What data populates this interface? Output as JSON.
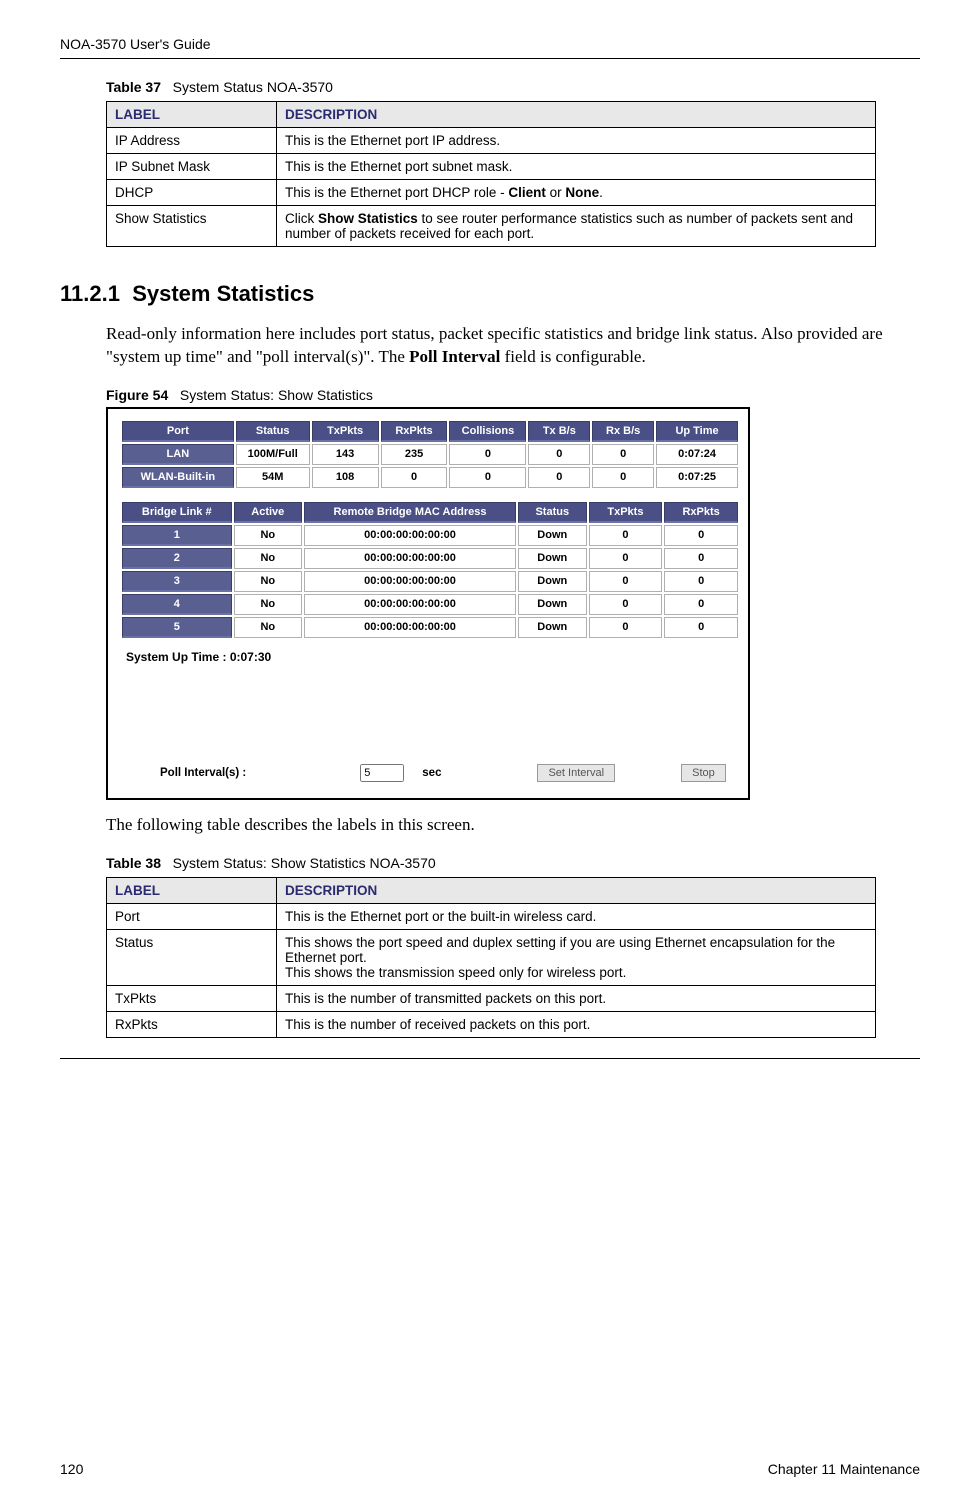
{
  "header": {
    "guide_title": "NOA-3570 User's Guide"
  },
  "table37": {
    "caption_prefix": "Table 37",
    "caption_text": "System Status NOA-3570",
    "col_label": "LABEL",
    "col_desc": "DESCRIPTION",
    "rows": [
      {
        "label": "IP Address",
        "desc": "This is the Ethernet port IP address."
      },
      {
        "label": "IP Subnet Mask",
        "desc": "This is the Ethernet port subnet mask."
      },
      {
        "label": "DHCP",
        "desc_pre": "This is the Ethernet port DHCP role - ",
        "b1": "Client",
        "mid": " or ",
        "b2": "None",
        "post": "."
      },
      {
        "label": "Show Statistics",
        "desc_pre": "Click ",
        "b1": "Show Statistics",
        "post": " to see router performance statistics such as number of packets sent and number of packets received for each port."
      }
    ]
  },
  "section": {
    "number": "11.2.1",
    "title": "System Statistics",
    "para_pre": "Read-only information here includes port status, packet specific statistics and bridge link status. Also provided are \"system up time\" and \"poll interval(s)\".  The ",
    "para_bold": "Poll Interval",
    "para_post": " field is configurable."
  },
  "figure54": {
    "caption_prefix": "Figure 54",
    "caption_text": "System Status: Show Statistics"
  },
  "chart_data": {
    "type": "table",
    "ports_table": {
      "headers": [
        "Port",
        "Status",
        "TxPkts",
        "RxPkts",
        "Collisions",
        "Tx B/s",
        "Rx B/s",
        "Up Time"
      ],
      "rows": [
        {
          "port": "LAN",
          "status": "100M/Full",
          "tx": "143",
          "rx": "235",
          "col": "0",
          "txbs": "0",
          "rxbs": "0",
          "up": "0:07:24"
        },
        {
          "port": "WLAN-Built-in",
          "status": "54M",
          "tx": "108",
          "rx": "0",
          "col": "0",
          "txbs": "0",
          "rxbs": "0",
          "up": "0:07:25"
        }
      ]
    },
    "bridge_table": {
      "headers": [
        "Bridge Link #",
        "Active",
        "Remote Bridge MAC Address",
        "Status",
        "TxPkts",
        "RxPkts"
      ],
      "rows": [
        {
          "n": "1",
          "active": "No",
          "mac": "00:00:00:00:00:00",
          "status": "Down",
          "tx": "0",
          "rx": "0"
        },
        {
          "n": "2",
          "active": "No",
          "mac": "00:00:00:00:00:00",
          "status": "Down",
          "tx": "0",
          "rx": "0"
        },
        {
          "n": "3",
          "active": "No",
          "mac": "00:00:00:00:00:00",
          "status": "Down",
          "tx": "0",
          "rx": "0"
        },
        {
          "n": "4",
          "active": "No",
          "mac": "00:00:00:00:00:00",
          "status": "Down",
          "tx": "0",
          "rx": "0"
        },
        {
          "n": "5",
          "active": "No",
          "mac": "00:00:00:00:00:00",
          "status": "Down",
          "tx": "0",
          "rx": "0"
        }
      ]
    },
    "system_up_time_label": "System Up Time :",
    "system_up_time_value": "0:07:30",
    "poll_label": "Poll Interval(s) :",
    "poll_value": "5",
    "poll_unit": "sec",
    "btn_set": "Set Interval",
    "btn_stop": "Stop"
  },
  "intro38": "The following table describes the labels in this screen.",
  "table38": {
    "caption_prefix": "Table 38",
    "caption_text": "System Status: Show Statistics NOA-3570",
    "col_label": "LABEL",
    "col_desc": "DESCRIPTION",
    "rows": [
      {
        "label": "Port",
        "desc": "This is the Ethernet port or the built-in wireless card."
      },
      {
        "label": "Status",
        "line1": "This shows the port speed and duplex setting if you are using Ethernet encapsulation for the Ethernet port.",
        "line2": "This shows the transmission speed only for wireless port."
      },
      {
        "label": "TxPkts",
        "desc": "This is the number of transmitted packets on this port."
      },
      {
        "label": "RxPkts",
        "desc": "This is the number of received packets on this port."
      }
    ]
  },
  "footer": {
    "page": "120",
    "chapter": "Chapter 11 Maintenance"
  }
}
